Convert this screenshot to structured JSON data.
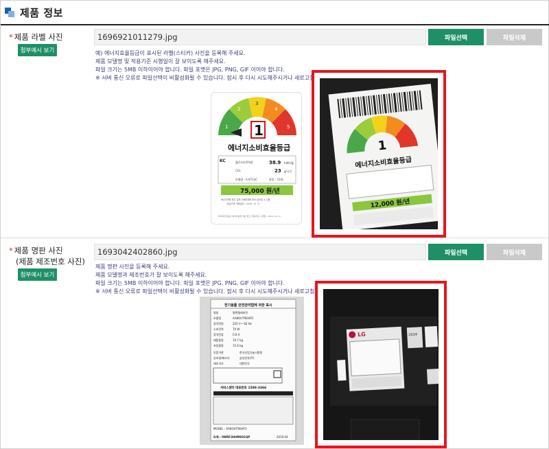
{
  "section": {
    "title": "제품 정보"
  },
  "row1": {
    "label": "제품 라벨 사진",
    "sample_button": "첨부예시 보기",
    "filename": "1696921011279.jpg",
    "select_button": "파일선택",
    "delete_button": "파일삭제",
    "notes": [
      "예) 에너지효율등급이 표시된 라벨(스티커) 사진을 등록해 주세요.",
      "제품 모델명 및 적용기준 시행일이 잘 보이도록 해주세요.",
      "파일 크기는 5MB 이하이어야 합니다. 파일 포맷은 JPG, PNG, GIF 이어야 합니다.",
      "※ 서버 통신 오류로 파일선택이 비활성화될 수 있습니다. 잠시 후 다시 시도해주시거나 새로고침 후 다시 시도해주시기 바랍니다."
    ],
    "label_card": {
      "grade": "1",
      "grade_title": "에너지소비효율등급",
      "line1_label": "월간소비전력량",
      "line1_value": "38.9",
      "line1_unit": "kWh/월",
      "line2_label": "CO₂",
      "line2_value": "23",
      "line2_unit": "g/시간",
      "model_label": "모델명 : A-9713C",
      "maker_label": "용량 : 724L",
      "price": "75,000 원/년",
      "footnote1": "에너지비용 등은 실제 사용환경에 따라 달라질 수 있음",
      "footnote2": "(등급기준 적용일자 : 2018. 10. 1)",
      "bottom_note": "에너지관리공단 에너지효율 자료 참고 (적용기준 시행일 : 2018. 10. 1)",
      "scale": [
        "1",
        "2",
        "3",
        "4",
        "5"
      ]
    },
    "photo": {
      "grade": "1",
      "title": "에너지소비효율등급",
      "price": "12,000 원/년"
    }
  },
  "row2": {
    "label_line1": "제품 명판 사진",
    "label_line2": "(제품 제조번호 사진)",
    "sample_button": "첨부예시 보기",
    "filename": "1693042402860.jpg",
    "select_button": "파일선택",
    "delete_button": "파일삭제",
    "notes": [
      "제품 명판 사진을 등록해 주세요.",
      "제품 모델명과 제조번호가 잘 보이도록 해주세요.",
      "파일 크기는 5MB 이하이어야 합니다. 파일 포맷은 JPG, PNG, GIF 이어야 합니다.",
      "※ 서버 통신 오류로 파일선택이 비활성화될 수 있습니다. 잠시 후 다시 시도해주시거나 새로고침 후 다시 시도해주시기 바랍니다."
    ],
    "nameplate": {
      "title": "전기용품 안전관리법에 의한 표시",
      "rows": [
        [
          "명칭",
          "평면텔레비전"
        ],
        [
          "모델명",
          "AA8OUT9EHFO"
        ],
        [
          "정격전원",
          "220 V~ 60 Hz"
        ],
        [
          "소비전력",
          "70 W"
        ],
        [
          "정격전류",
          "0.6 A"
        ],
        [
          "제품중량",
          "10.7 kg"
        ],
        [
          "포장중량",
          "15.6 kg"
        ],
        [
          "인증기관",
          "한국산업기술시험원"
        ],
        [
          "상호명/제조자",
          "삼성전자(주)"
        ],
        [
          "제조국가",
          "대한민국"
        ]
      ],
      "service": "서비스센터 대표번호 1588-3366",
      "model_line": "MODEL : AA8OUT9EHFO",
      "serial_line": "S/N : 0WRF3HHM001QP",
      "date_line": "2019.04"
    },
    "back_photo": {
      "brand": "LG",
      "year": "2014"
    }
  }
}
